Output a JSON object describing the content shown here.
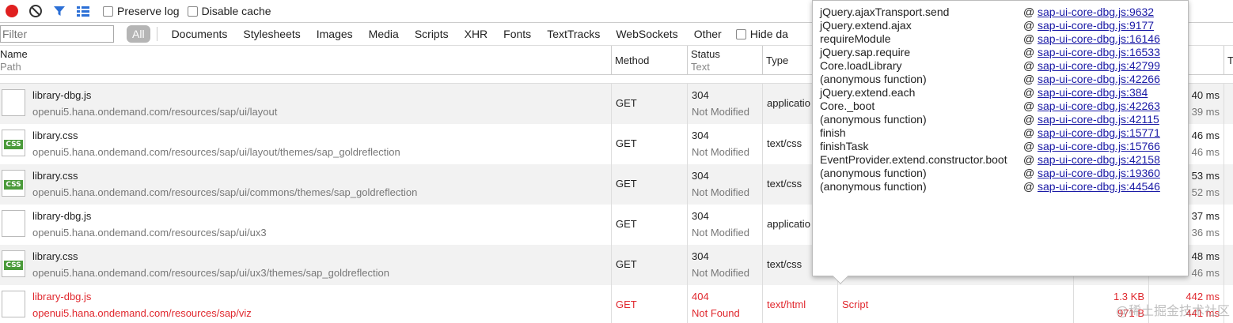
{
  "toolbar": {
    "preserve_log": "Preserve log",
    "disable_cache": "Disable cache"
  },
  "filterbar": {
    "placeholder": "Filter",
    "tabs": [
      "All",
      "Documents",
      "Stylesheets",
      "Images",
      "Media",
      "Scripts",
      "XHR",
      "Fonts",
      "TextTracks",
      "WebSockets",
      "Other"
    ],
    "hide_data": "Hide da"
  },
  "columns": {
    "name": "Name",
    "path": "Path",
    "method": "Method",
    "status": "Status",
    "status_sub": "Text",
    "type": "Type",
    "last": "T"
  },
  "rows": [
    {
      "name": "library-dbg.js",
      "path": "openui5.hana.ondemand.com/resources/sap/ui/layout",
      "method": "GET",
      "status": "304",
      "status_text": "Not Modified",
      "type": "applicatio",
      "time": "40 ms",
      "latency": "39 ms",
      "icon": "file-icon"
    },
    {
      "name": "library.css",
      "path": "openui5.hana.ondemand.com/resources/sap/ui/layout/themes/sap_goldreflection",
      "method": "GET",
      "status": "304",
      "status_text": "Not Modified",
      "type": "text/css",
      "time": "46 ms",
      "latency": "46 ms",
      "icon": "css-icon"
    },
    {
      "name": "library.css",
      "path": "openui5.hana.ondemand.com/resources/sap/ui/commons/themes/sap_goldreflection",
      "method": "GET",
      "status": "304",
      "status_text": "Not Modified",
      "type": "text/css",
      "time": "53 ms",
      "latency": "52 ms",
      "icon": "css-icon"
    },
    {
      "name": "library-dbg.js",
      "path": "openui5.hana.ondemand.com/resources/sap/ui/ux3",
      "method": "GET",
      "status": "304",
      "status_text": "Not Modified",
      "type": "applicatio",
      "time": "37 ms",
      "latency": "36 ms",
      "icon": "file-icon"
    },
    {
      "name": "library.css",
      "path": "openui5.hana.ondemand.com/resources/sap/ui/ux3/themes/sap_goldreflection",
      "method": "GET",
      "status": "304",
      "status_text": "Not Modified",
      "type": "text/css",
      "time": "48 ms",
      "latency": "46 ms",
      "icon": "css-icon"
    },
    {
      "name": "library-dbg.js",
      "path": "openui5.hana.ondemand.com/resources/sap/viz",
      "method": "GET",
      "status": "404",
      "status_text": "Not Found",
      "type": "text/html",
      "initiator": "Script",
      "size": "1.3 KB",
      "size_sub": "971 B",
      "time": "442 ms",
      "latency": "441 ms",
      "icon": "file-icon",
      "error": true
    }
  ],
  "stack": [
    {
      "fn": "jQuery.ajaxTransport.send",
      "at": "@",
      "loc": "sap-ui-core-dbg.js:9632"
    },
    {
      "fn": "jQuery.extend.ajax",
      "at": "@",
      "loc": "sap-ui-core-dbg.js:9177"
    },
    {
      "fn": "requireModule",
      "at": "@",
      "loc": "sap-ui-core-dbg.js:16146"
    },
    {
      "fn": "jQuery.sap.require",
      "at": "@",
      "loc": "sap-ui-core-dbg.js:16533"
    },
    {
      "fn": "Core.loadLibrary",
      "at": "@",
      "loc": "sap-ui-core-dbg.js:42799"
    },
    {
      "fn": "(anonymous function)",
      "at": "@",
      "loc": "sap-ui-core-dbg.js:42266"
    },
    {
      "fn": "jQuery.extend.each",
      "at": "@",
      "loc": "sap-ui-core-dbg.js:384"
    },
    {
      "fn": "Core._boot",
      "at": "@",
      "loc": "sap-ui-core-dbg.js:42263"
    },
    {
      "fn": "(anonymous function)",
      "at": "@",
      "loc": "sap-ui-core-dbg.js:42115"
    },
    {
      "fn": "finish",
      "at": "@",
      "loc": "sap-ui-core-dbg.js:15771"
    },
    {
      "fn": "finishTask",
      "at": "@",
      "loc": "sap-ui-core-dbg.js:15766"
    },
    {
      "fn": "EventProvider.extend.constructor.boot",
      "at": "@",
      "loc": "sap-ui-core-dbg.js:42158"
    },
    {
      "fn": "(anonymous function)",
      "at": "@",
      "loc": "sap-ui-core-dbg.js:19360"
    },
    {
      "fn": "(anonymous function)",
      "at": "@",
      "loc": "sap-ui-core-dbg.js:44546"
    }
  ],
  "watermark": "@稀土掘金技术社区",
  "colors": {
    "error": "#e0282e",
    "link": "#1a1aa6",
    "record": "#e02020",
    "active_tab": "#b5b5b5"
  }
}
